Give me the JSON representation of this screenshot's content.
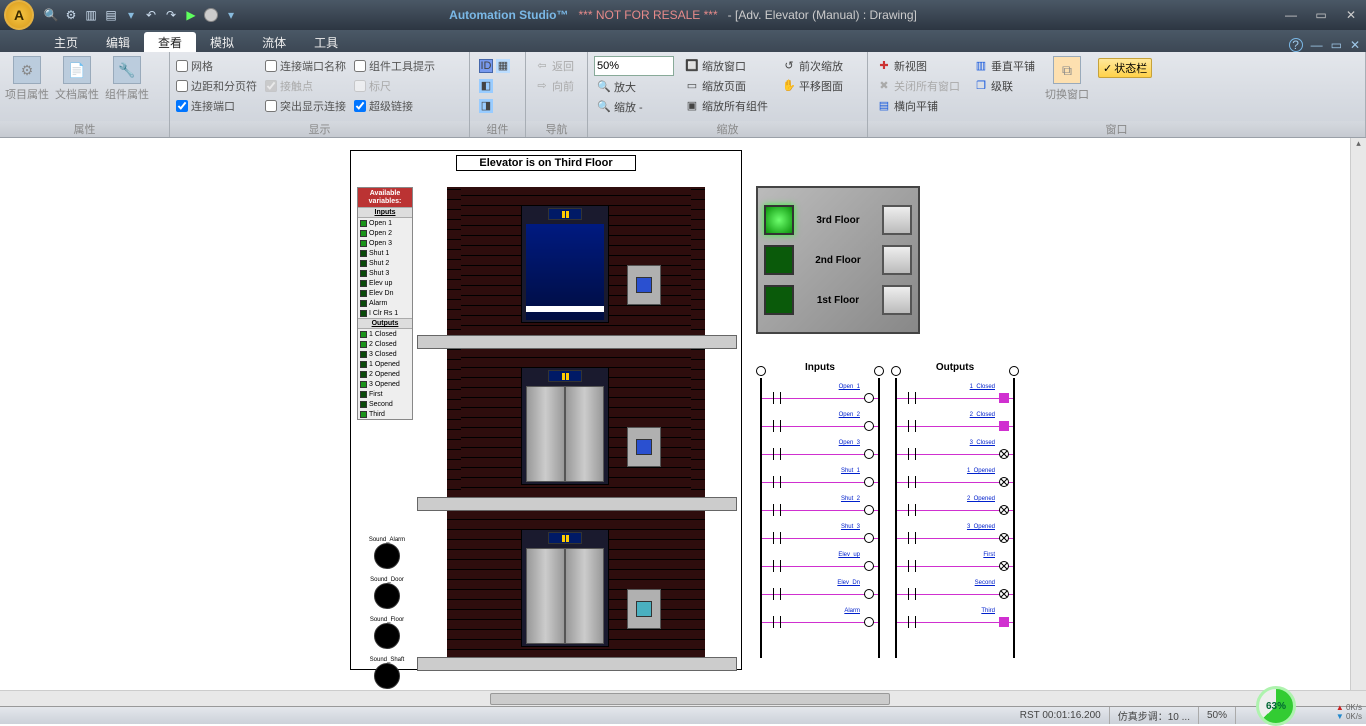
{
  "titlebar": {
    "app": "Automation Studio™",
    "warn": "*** NOT FOR RESALE ***",
    "doc": "- [Adv. Elevator (Manual) : Drawing]"
  },
  "menu": {
    "tabs": [
      "主页",
      "编辑",
      "查看",
      "模拟",
      "流体",
      "工具"
    ],
    "active_index": 2
  },
  "ribbon": {
    "group_props": {
      "label": "属性",
      "btns": [
        "项目属性",
        "文档属性",
        "组件属性"
      ]
    },
    "group_show": {
      "label": "显示",
      "col1": [
        {
          "label": "网格",
          "checked": false,
          "disabled": false
        },
        {
          "label": "边距和分页符",
          "checked": false,
          "disabled": false
        },
        {
          "label": "连接端口",
          "checked": true,
          "disabled": false
        }
      ],
      "col2": [
        {
          "label": "连接端口名称",
          "checked": false,
          "disabled": false
        },
        {
          "label": "接触点",
          "checked": true,
          "disabled": true
        },
        {
          "label": "突出显示连接",
          "checked": false,
          "disabled": false
        }
      ],
      "col3": [
        {
          "label": "组件工具提示",
          "checked": false,
          "disabled": false
        },
        {
          "label": "标尺",
          "checked": false,
          "disabled": true
        },
        {
          "label": "超级链接",
          "checked": true,
          "disabled": false
        }
      ]
    },
    "group_comp": {
      "label": "组件"
    },
    "group_nav": {
      "label": "导航",
      "back": "返回",
      "fwd": "向前"
    },
    "group_zoom": {
      "label": "缩放",
      "value": "50%",
      "btns": {
        "enlarge": "放大",
        "shrink": "缩放 -",
        "fit_window": "缩放窗口",
        "fit_page": "缩放页面",
        "fit_all": "缩放所有组件",
        "prev": "前次缩放",
        "pan": "平移图面"
      }
    },
    "group_window": {
      "label": "窗口",
      "btns": {
        "newview": "新视图",
        "close_all": "关闭所有窗口",
        "htile": "横向平铺",
        "vtile": "垂直平铺",
        "cascade": "级联",
        "switch": "切换窗口",
        "status": "状态栏"
      }
    }
  },
  "page_title": "Elevator is on Third Floor",
  "var_panel": {
    "header": "Available variables:",
    "inputs_label": "Inputs",
    "outputs_label": "Outputs",
    "inputs": [
      {
        "label": "Open 1",
        "on": true
      },
      {
        "label": "Open 2",
        "on": true
      },
      {
        "label": "Open 3",
        "on": true
      },
      {
        "label": "Shut 1",
        "on": false
      },
      {
        "label": "Shut 2",
        "on": false
      },
      {
        "label": "Shut 3",
        "on": false
      },
      {
        "label": "Elev up",
        "on": false
      },
      {
        "label": "Elev Dn",
        "on": false
      },
      {
        "label": "Alarm",
        "on": false
      },
      {
        "label": "I Clr Rs 1",
        "on": false
      }
    ],
    "outputs": [
      {
        "label": "1 Closed",
        "on": true
      },
      {
        "label": "2 Closed",
        "on": true
      },
      {
        "label": "3 Closed",
        "on": false
      },
      {
        "label": "1 Opened",
        "on": false
      },
      {
        "label": "2 Opened",
        "on": false
      },
      {
        "label": "3 Opened",
        "on": true
      },
      {
        "label": "First",
        "on": false
      },
      {
        "label": "Second",
        "on": false
      },
      {
        "label": "Third",
        "on": true
      }
    ]
  },
  "sounds": [
    "Sound_Alarm",
    "Sound_Door",
    "Sound_Floor",
    "Sound_Shaft"
  ],
  "floor_panel": [
    {
      "label": "3rd Floor",
      "on": true
    },
    {
      "label": "2nd Floor",
      "on": false
    },
    {
      "label": "1st Floor",
      "on": false
    }
  ],
  "ladder": {
    "inputs_title": "Inputs",
    "outputs_title": "Outputs",
    "inputs": [
      "Open_1",
      "Open_2",
      "Open_3",
      "Shut_1",
      "Shut_2",
      "Shut_3",
      "Elev_up",
      "Elev_Dn",
      "Alarm"
    ],
    "outputs": [
      "1_Closed",
      "2_Closed",
      "3_Closed",
      "1_Opened",
      "2_Opened",
      "3_Opened",
      "First",
      "Second",
      "Third"
    ]
  },
  "status": {
    "rst": "RST 00:01:16.200",
    "step": "仿真步调：10 ...",
    "zoom": "50%",
    "gauge": "63%",
    "rate": "0K/s"
  }
}
